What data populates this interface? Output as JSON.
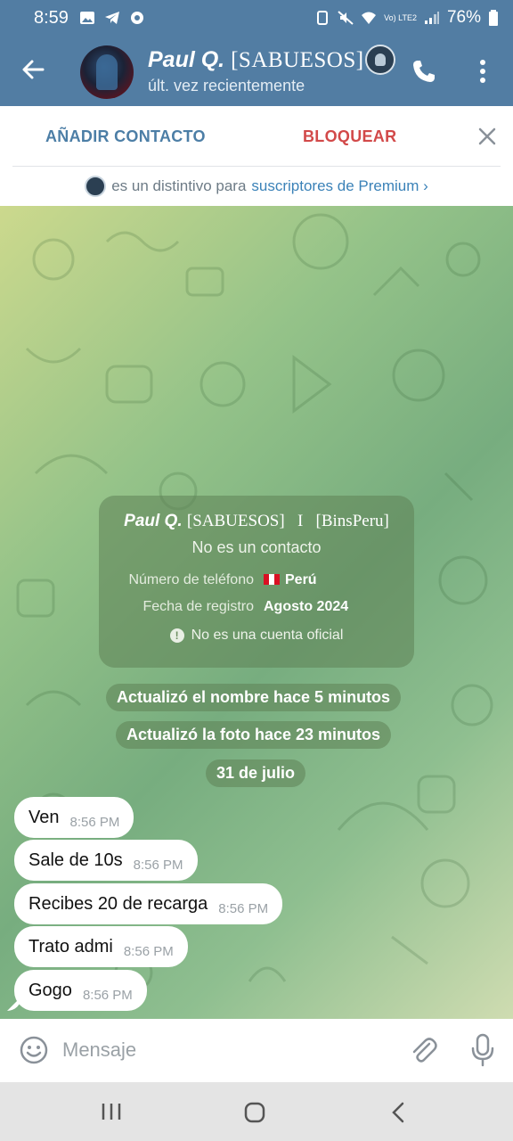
{
  "status_bar": {
    "time": "8:59",
    "battery": "76%",
    "network": "Vo) LTE2"
  },
  "header": {
    "name": "Paul Q.",
    "name_tag": "[SABUESOS]",
    "last_seen": "últ. vez recientemente"
  },
  "actions": {
    "add_contact": "AÑADIR CONTACTO",
    "block": "BLOQUEAR"
  },
  "premium_notice": {
    "text": "es un distintivo para",
    "link": "suscriptores de Premium ›"
  },
  "info_card": {
    "name": "Paul Q.",
    "tags": "[SABUESOS]   I   [BinsPeru]",
    "subtitle": "No es un contacto",
    "phone_label": "Número de teléfono",
    "phone_value": "Perú",
    "registered_label": "Fecha de registro",
    "registered_value": "Agosto 2024",
    "official_notice": "No es una cuenta oficial"
  },
  "service_messages": {
    "name_updated": "Actualizó el nombre hace 5 minutos",
    "photo_updated": "Actualizó la foto hace 23 minutos",
    "date": "31 de julio"
  },
  "messages": [
    {
      "text": "Ven",
      "time": "8:56 PM"
    },
    {
      "text": "Sale de 10s",
      "time": "8:56 PM"
    },
    {
      "text": "Recibes 20 de recarga",
      "time": "8:56 PM"
    },
    {
      "text": "Trato admi",
      "time": "8:56 PM"
    },
    {
      "text": "Gogo",
      "time": "8:56 PM"
    }
  ],
  "composer": {
    "placeholder": "Mensaje"
  },
  "colors": {
    "header_bg": "#527da3",
    "accent_blue": "#4c7ea6",
    "block_red": "#d24949",
    "link_blue": "#3b82b8"
  },
  "icons": [
    "back-arrow-icon",
    "phone-icon",
    "more-vert-icon",
    "close-icon",
    "premium-badge-icon",
    "emoji-icon",
    "attach-icon",
    "mic-icon",
    "flag-peru-icon",
    "warning-icon"
  ]
}
